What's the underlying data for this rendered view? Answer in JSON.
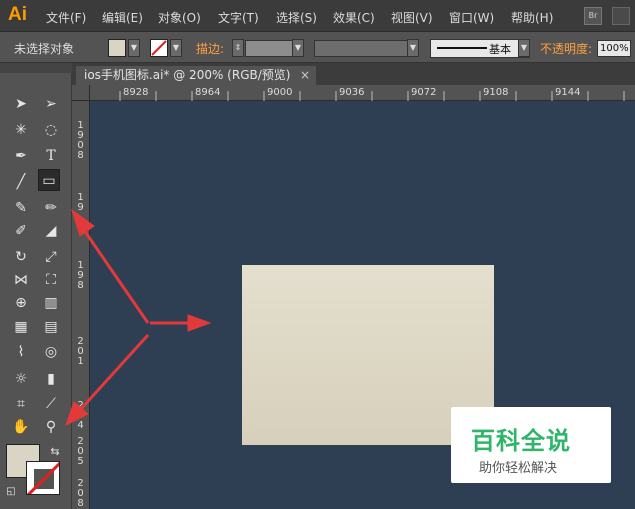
{
  "app": {
    "logo": "Ai"
  },
  "menu": [
    "文件(F)",
    "编辑(E)",
    "对象(O)",
    "文字(T)",
    "选择(S)",
    "效果(C)",
    "视图(V)",
    "窗口(W)",
    "帮助(H)"
  ],
  "bridge_label": "Br",
  "control_bar": {
    "selection_status": "未选择对象",
    "stroke_label": "描边:",
    "stroke_style": "基本",
    "opacity_label": "不透明度:",
    "opacity_value": "100%"
  },
  "document_tab": {
    "title": "ios手机图标.ai* @ 200% (RGB/预览)",
    "close": "×"
  },
  "ruler_top": [
    "8928",
    "8964",
    "9000",
    "9036",
    "9072",
    "9108",
    "9144"
  ],
  "ruler_left": [
    "1908",
    "19",
    "198",
    "201",
    "204",
    "205",
    "208"
  ],
  "watermark": {
    "title": "百科全说",
    "subtitle": "助你轻松解决"
  },
  "colors": {
    "canvas": "#2f3f53",
    "fill": "#d9d4c3",
    "arrow": "#e23a3a",
    "watermark_green": "#2fb56a"
  },
  "icons": [
    "selection-tool-icon",
    "direct-selection-tool-icon",
    "magic-wand-icon",
    "lasso-icon",
    "pen-tool-icon",
    "type-tool-icon",
    "line-tool-icon",
    "rectangle-tool-icon",
    "paintbrush-icon",
    "pencil-icon",
    "blob-brush-icon",
    "eraser-icon",
    "rotate-icon",
    "scale-icon",
    "width-tool-icon",
    "free-transform-icon",
    "shape-builder-icon",
    "perspective-grid-icon",
    "mesh-icon",
    "gradient-icon",
    "eyedropper-icon",
    "blend-icon",
    "symbol-sprayer-icon",
    "graph-icon",
    "artboard-icon",
    "slice-icon",
    "hand-icon",
    "zoom-icon"
  ]
}
